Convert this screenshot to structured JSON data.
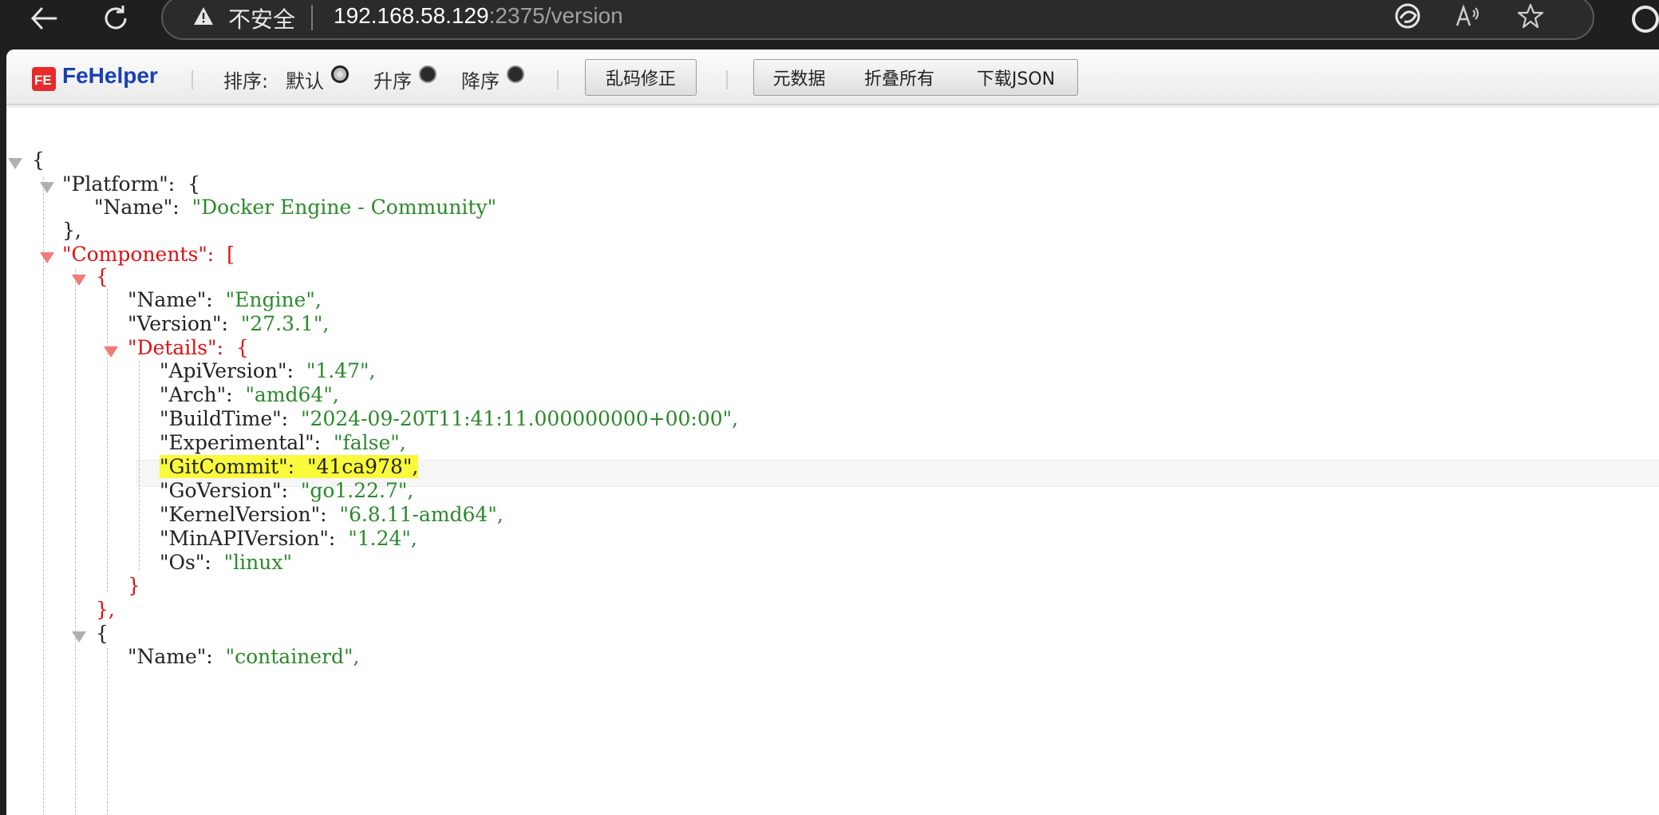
{
  "browser": {
    "security_label": "不安全",
    "url_host": "192.168.58.129",
    "url_rest": ":2375/version"
  },
  "toolbar": {
    "logo_text": "FeHelper",
    "sort_label": "排序:",
    "sort_default": "默认",
    "sort_asc": "升序",
    "sort_desc": "降序",
    "fix_encoding": "乱码修正",
    "metadata": "元数据",
    "collapse_all": "折叠所有",
    "download_json": "下载JSON"
  },
  "json": {
    "l1": "{",
    "platform_key": "\"Platform\":",
    "platform_open": "{",
    "platform_name_key": "\"Name\":",
    "platform_name_val": "\"Docker Engine - Community\"",
    "platform_close": "},",
    "components_key": "\"Components\":",
    "components_open": "[",
    "c0_open": "{",
    "c0_name_key": "\"Name\":",
    "c0_name_val": "\"Engine\",",
    "c0_version_key": "\"Version\":",
    "c0_version_val": "\"27.3.1\",",
    "details_key": "\"Details\":",
    "details_open": "{",
    "d_apiversion_key": "\"ApiVersion\":",
    "d_apiversion_val": "\"1.47\",",
    "d_arch_key": "\"Arch\":",
    "d_arch_val": "\"amd64\",",
    "d_buildtime_key": "\"BuildTime\":",
    "d_buildtime_val": "\"2024-09-20T11:41:11.000000000+00:00\",",
    "d_experimental_key": "\"Experimental\":",
    "d_experimental_val": "\"false\",",
    "d_gitcommit_line": "\"GitCommit\":  \"41ca978\",",
    "d_goversion_key": "\"GoVersion\":",
    "d_goversion_val": "\"go1.22.7\",",
    "d_kernel_key": "\"KernelVersion\":",
    "d_kernel_val": "\"6.8.11-amd64\",",
    "d_minapi_key": "\"MinAPIVersion\":",
    "d_minapi_val": "\"1.24\",",
    "d_os_key": "\"Os\":",
    "d_os_val": "\"linux\"",
    "details_close": "}",
    "c0_close": "},",
    "c1_open": "{",
    "c1_name_key": "\"Name\":",
    "c1_name_val": "\"containerd\","
  }
}
